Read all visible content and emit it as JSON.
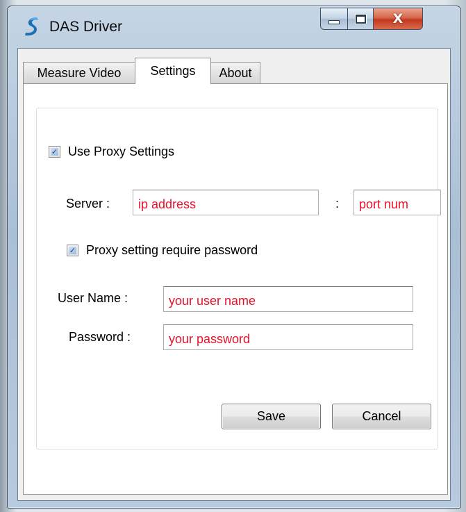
{
  "window": {
    "title": "DAS Driver",
    "app_icon": "das-logo-icon",
    "controls": [
      "minimize-icon",
      "maximize-icon",
      "close-icon"
    ],
    "close_glyph": "X"
  },
  "tabs": [
    {
      "label": "Measure Video",
      "active": false
    },
    {
      "label": "Settings",
      "active": true
    },
    {
      "label": "About",
      "active": false
    }
  ],
  "settings": {
    "use_proxy": {
      "label": "Use Proxy Settings",
      "checked": true
    },
    "server": {
      "label": "Server :",
      "separator": ":",
      "ip_placeholder": "ip address",
      "port_placeholder": "port num"
    },
    "require_password": {
      "label": "Proxy setting require password",
      "checked": true
    },
    "username": {
      "label": "User Name :",
      "placeholder": "your user name"
    },
    "password": {
      "label": "Password :",
      "placeholder": "your password"
    },
    "save_label": "Save",
    "cancel_label": "Cancel"
  },
  "colors": {
    "placeholder_text": "#e5122a",
    "checkbox_check": "#1d3f75",
    "close_button": "#c2381f"
  }
}
